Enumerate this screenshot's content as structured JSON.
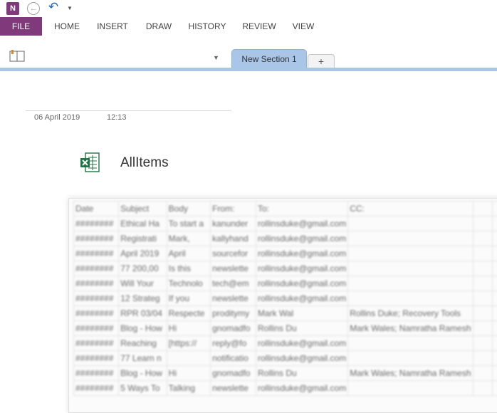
{
  "app": {
    "logo_letter": "N"
  },
  "ribbon": {
    "tabs": [
      {
        "label": "FILE"
      },
      {
        "label": "HOME"
      },
      {
        "label": "INSERT"
      },
      {
        "label": "DRAW"
      },
      {
        "label": "HISTORY"
      },
      {
        "label": "REVIEW"
      },
      {
        "label": "VIEW"
      }
    ]
  },
  "sections": {
    "active": "New Section 1",
    "add_label": "+"
  },
  "page": {
    "date": "06 April 2019",
    "time": "12:13"
  },
  "attachment": {
    "file_name": "AllItems"
  },
  "table": {
    "headers": [
      "Date",
      "Subject",
      "Body",
      "From:",
      "To:",
      "CC:"
    ],
    "rows": [
      [
        "########",
        "Ethical Ha",
        "To start a",
        "kanunder",
        "rollinsduke@gmail.com",
        ""
      ],
      [
        "########",
        "Registrati",
        "Mark,",
        "kallyhand",
        "rollinsduke@gmail.com",
        ""
      ],
      [
        "########",
        "April 2019",
        "April",
        "sourcefor",
        "rollinsduke@gmail.com",
        ""
      ],
      [
        "########",
        "77 200,00",
        "Is this",
        "newslette",
        "rollinsduke@gmail.com",
        ""
      ],
      [
        "########",
        "Will Your",
        "Technolo",
        "tech@em",
        "rollinsduke@gmail.com",
        ""
      ],
      [
        "########",
        "12 Strateg",
        "If you",
        "newslette",
        "rollinsduke@gmail.com",
        ""
      ],
      [
        "########",
        "RPR 03/04",
        "Respecte",
        "proditymy",
        "Mark Wal",
        "Rollins Duke; Recovery Tools"
      ],
      [
        "########",
        "Blog - How",
        "Hi",
        "gnomadfo",
        "Rollins Du",
        "Mark Wales; Namratha Ramesh"
      ],
      [
        "########",
        "Reaching",
        "[https://",
        "reply@fo",
        "rollinsduke@gmail.com",
        ""
      ],
      [
        "########",
        "77 Learn n",
        "",
        "notificatio",
        "rollinsduke@gmail.com",
        ""
      ],
      [
        "########",
        "Blog - How",
        "Hi",
        "gnomadfo",
        "Rollins Du",
        "Mark Wales; Namratha Ramesh"
      ],
      [
        "########",
        "5 Ways To",
        "Talking",
        "newslette",
        "rollinsduke@gmail.com",
        ""
      ]
    ]
  },
  "colors": {
    "onenote_purple": "#80397b",
    "section_blue": "#a9c6e8",
    "excel_green": "#217346",
    "undo_blue": "#1e5fb4"
  },
  "icons": {
    "back": "back-arrow-icon",
    "undo": "undo-icon",
    "notebook": "notebook-icon",
    "excel": "excel-file-icon"
  }
}
